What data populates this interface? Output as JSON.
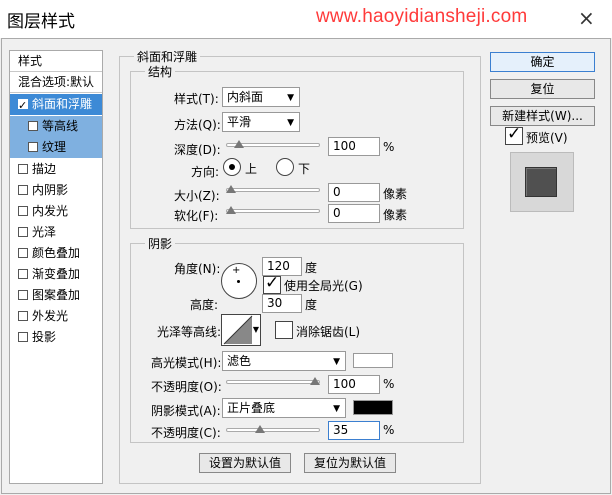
{
  "window": {
    "title": "图层样式",
    "watermark": "www.haoyidiansheji.com",
    "close_glyph": "×"
  },
  "style_list": {
    "items": [
      {
        "label": "样式",
        "checkbox": false,
        "checked": false
      },
      {
        "label": "混合选项:默认",
        "checkbox": false,
        "checked": false
      },
      {
        "label": "斜面和浮雕",
        "checkbox": true,
        "checked": true
      },
      {
        "label": "等高线",
        "checkbox": true,
        "checked": false
      },
      {
        "label": "纹理",
        "checkbox": true,
        "checked": false
      },
      {
        "label": "描边",
        "checkbox": true,
        "checked": false
      },
      {
        "label": "内阴影",
        "checkbox": true,
        "checked": false
      },
      {
        "label": "内发光",
        "checkbox": true,
        "checked": false
      },
      {
        "label": "光泽",
        "checkbox": true,
        "checked": false
      },
      {
        "label": "颜色叠加",
        "checkbox": true,
        "checked": false
      },
      {
        "label": "渐变叠加",
        "checkbox": true,
        "checked": false
      },
      {
        "label": "图案叠加",
        "checkbox": true,
        "checked": false
      },
      {
        "label": "外发光",
        "checkbox": true,
        "checked": false
      },
      {
        "label": "投影",
        "checkbox": true,
        "checked": false
      }
    ]
  },
  "bevel": {
    "group_title": "斜面和浮雕",
    "structure": {
      "title": "结构",
      "style_label": "样式(T):",
      "style_value": "内斜面",
      "technique_label": "方法(Q):",
      "technique_value": "平滑",
      "depth_label": "深度(D):",
      "depth_value": "100",
      "depth_unit": "%",
      "depth_fraction": 0.1,
      "direction_label": "方向:",
      "direction_up": "上",
      "direction_down": "下",
      "size_label": "大小(Z):",
      "size_value": "0",
      "size_unit": "像素",
      "size_fraction": 0.0,
      "soften_label": "软化(F):",
      "soften_value": "0",
      "soften_unit": "像素",
      "soften_fraction": 0.0
    },
    "shading": {
      "title": "阴影",
      "angle_label": "角度(N):",
      "angle_value": "120",
      "angle_unit": "度",
      "global_light_label": "使用全局光(G)",
      "altitude_label": "高度:",
      "altitude_value": "30",
      "altitude_unit": "度",
      "gloss_contour_label": "光泽等高线:",
      "anti_alias_label": "消除锯齿(L)",
      "highlight_mode_label": "高光模式(H):",
      "highlight_mode_value": "滤色",
      "highlight_color": "#ffffff",
      "highlight_opacity_label": "不透明度(O):",
      "highlight_opacity_value": "100",
      "highlight_opacity_fraction": 1.0,
      "shadow_mode_label": "阴影模式(A):",
      "shadow_mode_value": "正片叠底",
      "shadow_color": "#000000",
      "shadow_opacity_label": "不透明度(C):",
      "shadow_opacity_value": "35",
      "shadow_opacity_fraction": 0.35,
      "percent": "%"
    },
    "make_default": "设置为默认值",
    "reset_default": "复位为默认值"
  },
  "right_panel": {
    "ok": "确定",
    "reset": "复位",
    "new_style": "新建样式(W)...",
    "preview_label": "预览(V)",
    "preview_checked": true
  },
  "icons": {
    "dropdown": "chevron-down-icon",
    "close": "close-icon",
    "check": "check-icon"
  }
}
